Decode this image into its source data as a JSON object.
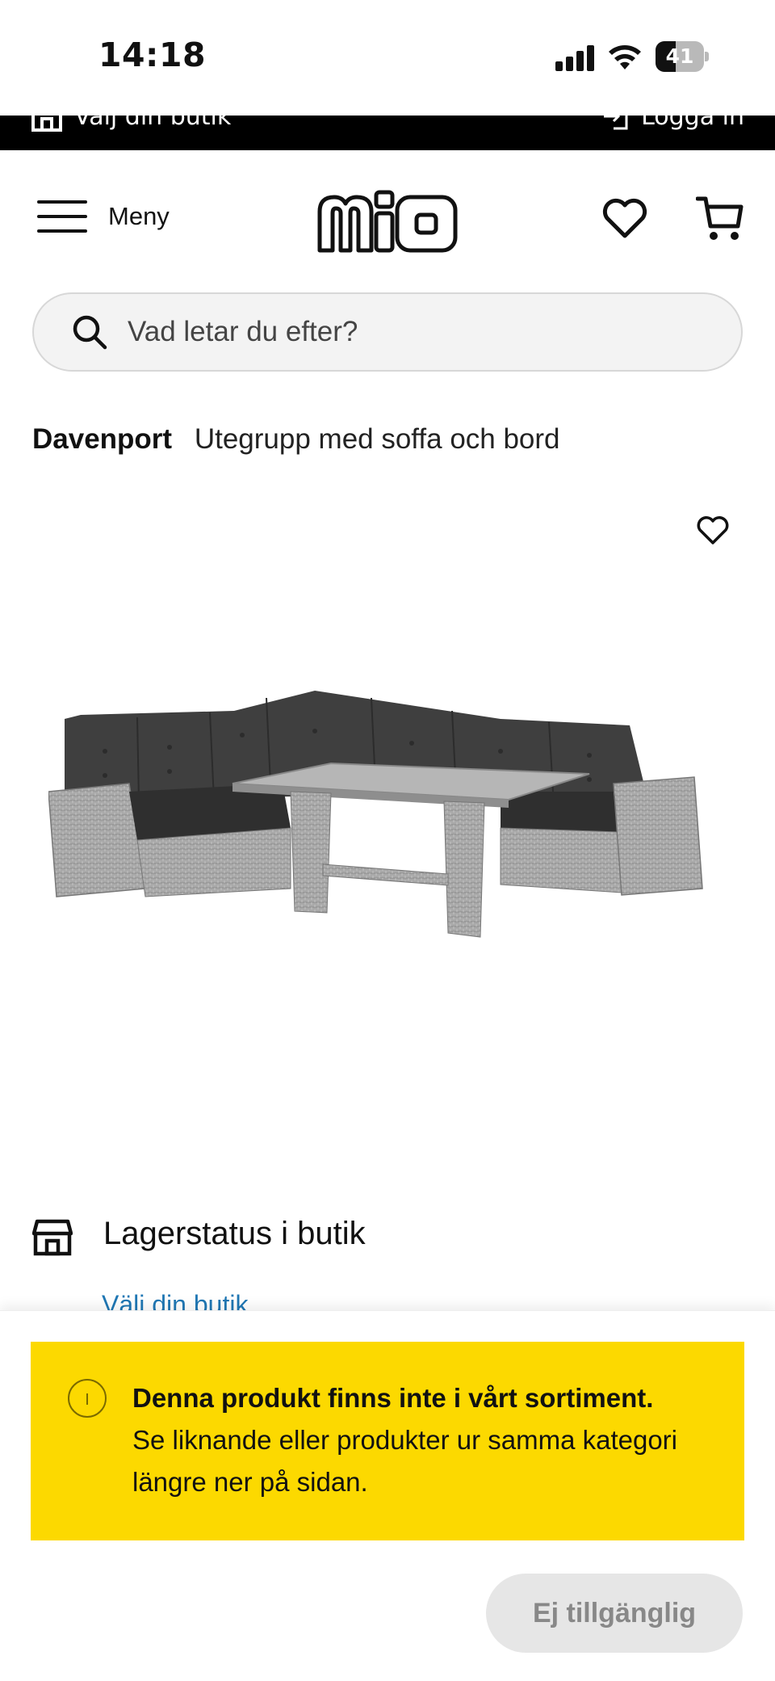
{
  "status_bar": {
    "time": "14:18",
    "battery": "41",
    "battery_level": 0.41
  },
  "top_strip": {
    "store_link": "Välj din butik",
    "login_link": "Logga in"
  },
  "header": {
    "menu_label": "Meny",
    "logo_text": "mio",
    "icons": [
      "heart-icon",
      "cart-icon",
      "hamburger-icon"
    ]
  },
  "search": {
    "placeholder": "Vad letar du efter?"
  },
  "product": {
    "brand": "Davenport",
    "name": "Utegrupp med soffa och bord"
  },
  "stock": {
    "label": "Lagerstatus i butik",
    "choose_store": "Välj din butik"
  },
  "notice": {
    "title": "Denna produkt finns inte i vårt sortiment.",
    "body": "Se liknande eller produkter ur samma kategori längre ner på sidan.",
    "color": "#fcd900"
  },
  "actions": {
    "unavailable_label": "Ej tillgänglig"
  }
}
